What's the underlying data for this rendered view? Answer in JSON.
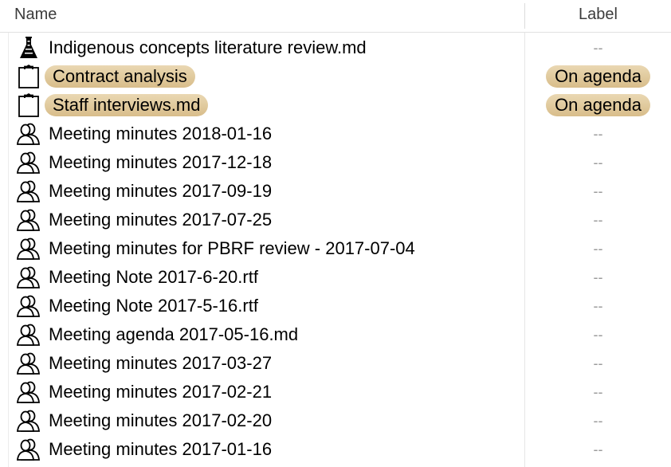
{
  "columns": {
    "name": "Name",
    "label": "Label"
  },
  "colors": {
    "tag_bg": "#dcc392",
    "placeholder": "#9a9a9a"
  },
  "rows": [
    {
      "icon": "flask-icon",
      "name": "Indigenous concepts literature review.md",
      "label": "--",
      "tagged": false
    },
    {
      "icon": "clipboard-icon",
      "name": "Contract analysis",
      "label": "On agenda",
      "tagged": true
    },
    {
      "icon": "clipboard-icon",
      "name": "Staff interviews.md",
      "label": "On agenda",
      "tagged": true
    },
    {
      "icon": "people-icon",
      "name": "Meeting minutes 2018-01-16",
      "label": "--",
      "tagged": false
    },
    {
      "icon": "people-icon",
      "name": "Meeting minutes 2017-12-18",
      "label": "--",
      "tagged": false
    },
    {
      "icon": "people-icon",
      "name": "Meeting minutes 2017-09-19",
      "label": "--",
      "tagged": false
    },
    {
      "icon": "people-icon",
      "name": "Meeting minutes 2017-07-25",
      "label": "--",
      "tagged": false
    },
    {
      "icon": "people-icon",
      "name": "Meeting minutes for PBRF review - 2017-07-04",
      "label": "--",
      "tagged": false
    },
    {
      "icon": "people-icon",
      "name": "Meeting Note 2017-6-20.rtf",
      "label": "--",
      "tagged": false
    },
    {
      "icon": "people-icon",
      "name": "Meeting Note 2017-5-16.rtf",
      "label": "--",
      "tagged": false
    },
    {
      "icon": "people-icon",
      "name": "Meeting agenda 2017-05-16.md",
      "label": "--",
      "tagged": false
    },
    {
      "icon": "people-icon",
      "name": "Meeting minutes 2017-03-27",
      "label": "--",
      "tagged": false
    },
    {
      "icon": "people-icon",
      "name": "Meeting minutes 2017-02-21",
      "label": "--",
      "tagged": false
    },
    {
      "icon": "people-icon",
      "name": "Meeting minutes 2017-02-20",
      "label": "--",
      "tagged": false
    },
    {
      "icon": "people-icon",
      "name": "Meeting minutes 2017-01-16",
      "label": "--",
      "tagged": false
    }
  ]
}
